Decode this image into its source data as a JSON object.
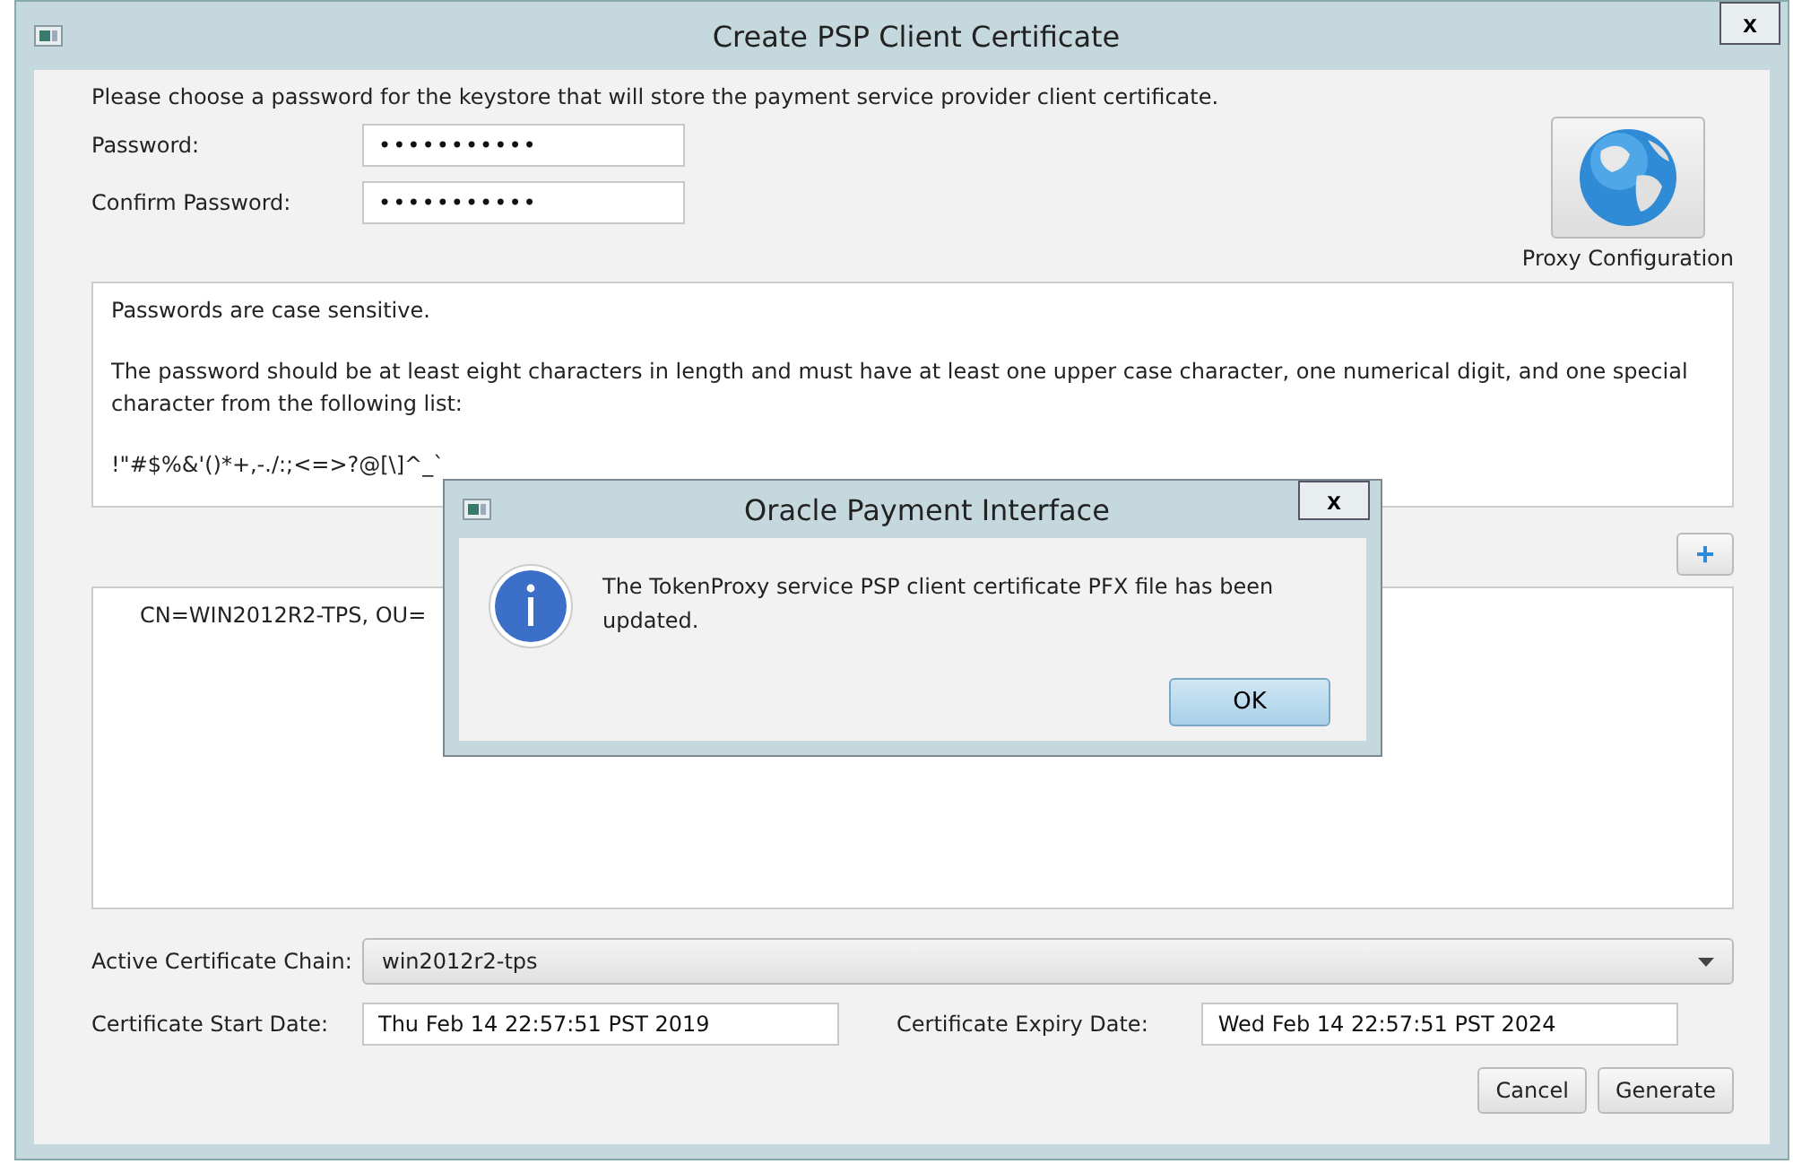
{
  "window": {
    "title": "Create PSP Client Certificate",
    "close": "x"
  },
  "intro": "Please choose a password for the keystore that will store the payment service provider client certificate.",
  "password_fields": [
    {
      "label": "Password:",
      "value": "•••••••••••"
    },
    {
      "label": "Confirm Password:",
      "value": "•••••••••••"
    }
  ],
  "proxy_button": {
    "label": "Proxy Configuration"
  },
  "info_lines": [
    "Passwords are case sensitive.",
    "The password should be at least eight characters in length and must have at least one upper case character, one numerical digit, and one special character from the following list:",
    "!\"#$%&'()*+,-./:;<=>?@[\\]^_`"
  ],
  "add_button": "+",
  "certificates": [
    {
      "text": "CN=WIN2012R2-TPS, OU="
    }
  ],
  "chain": {
    "label": "Active Certificate Chain:",
    "value": "win2012r2-tps"
  },
  "start_date": {
    "label": "Certificate Start Date:",
    "value": "Thu Feb 14 22:57:51 PST 2019"
  },
  "expiry_date": {
    "label": "Certificate Expiry Date:",
    "value": "Wed Feb 14 22:57:51 PST 2024"
  },
  "buttons": [
    "Cancel",
    "Generate"
  ],
  "dialog": {
    "title": "Oracle Payment Interface",
    "close": "x",
    "message": "The TokenProxy service PSP client certificate PFX file has been updated.",
    "button": "OK"
  }
}
